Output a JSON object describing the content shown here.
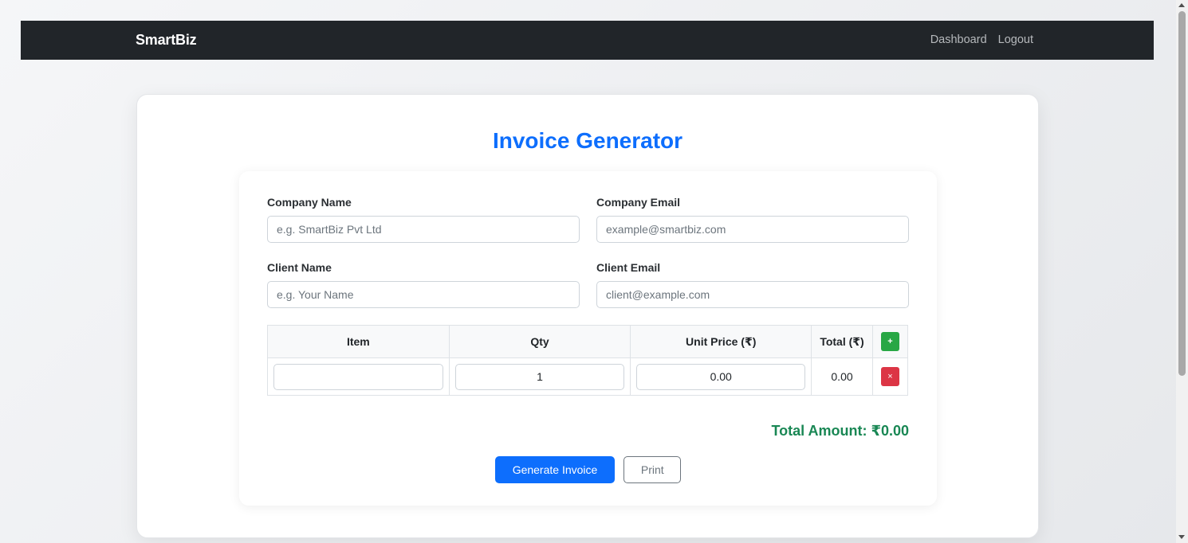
{
  "navbar": {
    "brand": "SmartBiz",
    "links": [
      "Dashboard",
      "Logout"
    ]
  },
  "page": {
    "title": "Invoice Generator"
  },
  "form": {
    "company_name": {
      "label": "Company Name",
      "placeholder": "e.g. SmartBiz Pvt Ltd",
      "value": ""
    },
    "company_email": {
      "label": "Company Email",
      "placeholder": "example@smartbiz.com",
      "value": ""
    },
    "client_name": {
      "label": "Client Name",
      "placeholder": "e.g. Your Name",
      "value": ""
    },
    "client_email": {
      "label": "Client Email",
      "placeholder": "client@example.com",
      "value": ""
    }
  },
  "items_table": {
    "headers": [
      "Item",
      "Qty",
      "Unit Price (₹)",
      "Total (₹)"
    ],
    "add_icon": "+",
    "remove_icon": "×",
    "rows": [
      {
        "item": "",
        "qty": "1",
        "unit_price": "0.00",
        "total": "0.00"
      }
    ]
  },
  "summary": {
    "total_amount": "Total Amount: ₹0.00"
  },
  "actions": {
    "generate_label": "Generate Invoice",
    "print_label": "Print"
  },
  "colors": {
    "navbar_bg": "#212529",
    "accent": "#0d6efd",
    "success": "#198754",
    "add_button": "#28a745",
    "danger": "#dc3545"
  }
}
